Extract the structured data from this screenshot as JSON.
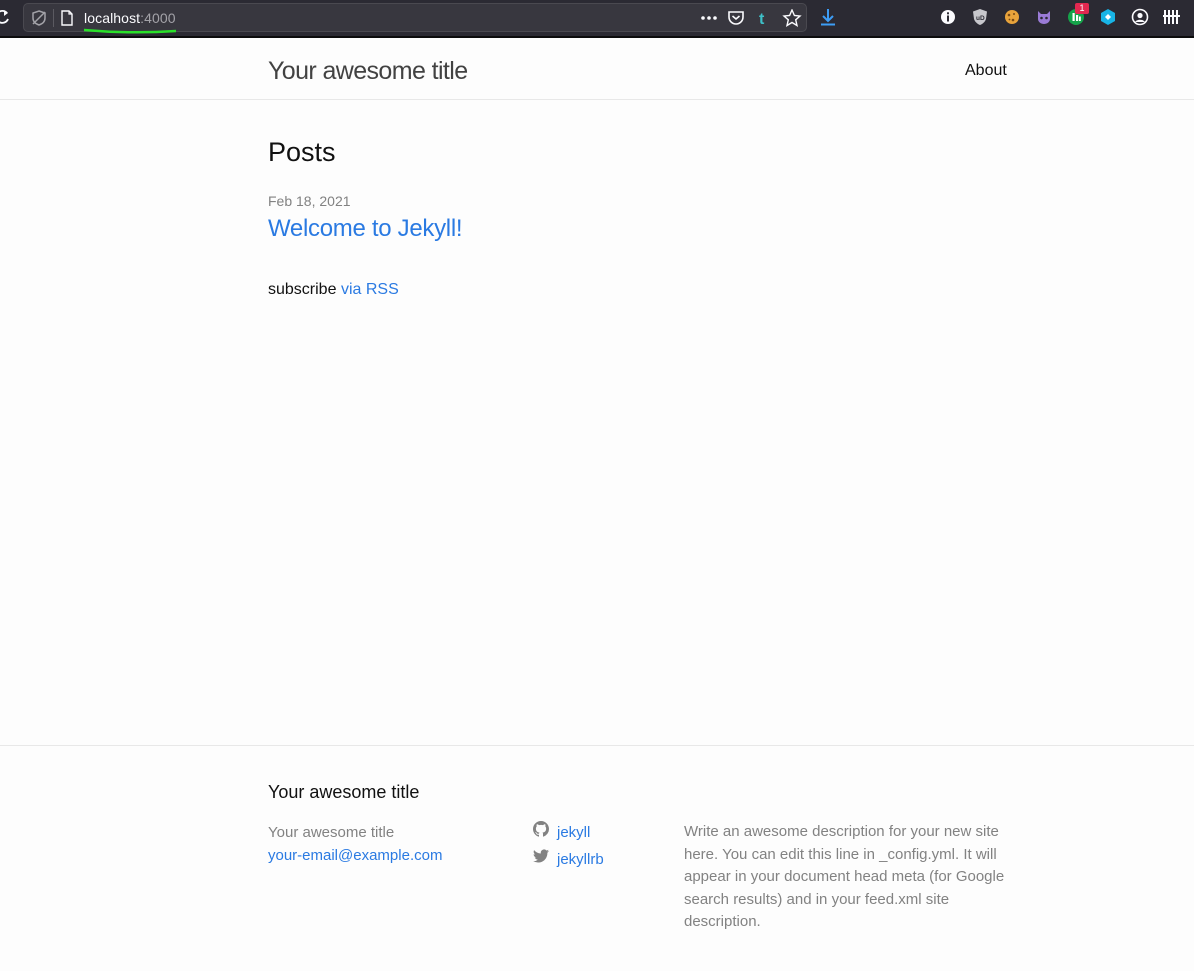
{
  "browser": {
    "url_host": "localhost",
    "url_port": ":4000",
    "extension_badge": "1",
    "accent": "#2ae02a"
  },
  "header": {
    "site_title": "Your awesome title",
    "nav": [
      {
        "label": "About"
      }
    ]
  },
  "main": {
    "heading": "Posts",
    "posts": [
      {
        "date": "Feb 18, 2021",
        "title": "Welcome to Jekyll!"
      }
    ],
    "rss_prefix": "subscribe",
    "rss_link": "via RSS"
  },
  "footer": {
    "heading": "Your awesome title",
    "col1_title": "Your awesome title",
    "email": "your-email@example.com",
    "social": [
      {
        "icon": "github-icon",
        "label": "jekyll"
      },
      {
        "icon": "twitter-icon",
        "label": "jekyllrb"
      }
    ],
    "description": "Write an awesome description for your new site here. You can edit this line in _config.yml. It will appear in your document head meta (for Google search results) and in your feed.xml site description."
  },
  "colors": {
    "link": "#2a7ae2",
    "muted": "#828282",
    "text": "#111111",
    "toolbar": "#2b2a33"
  }
}
